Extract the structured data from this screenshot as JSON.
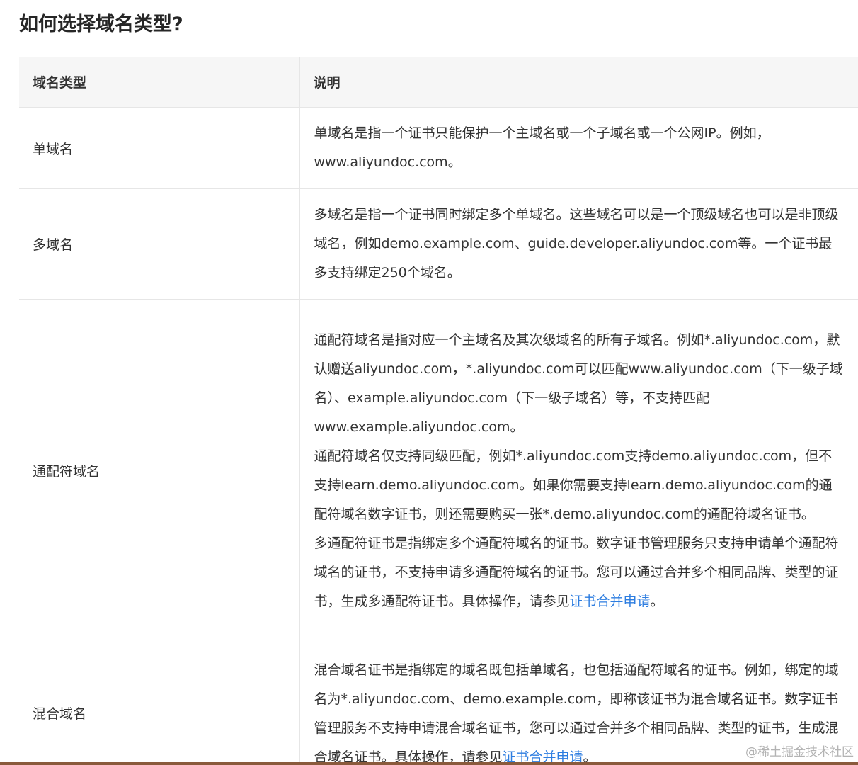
{
  "title": "如何选择域名类型?",
  "table": {
    "headers": [
      "域名类型",
      "说明"
    ],
    "rows": [
      {
        "type": "单域名",
        "paragraphs": [
          {
            "text": "单域名是指一个证书只能保护一个主域名或一个子域名或一个公网IP。例如，www.aliyundoc.com。"
          }
        ]
      },
      {
        "type": "多域名",
        "paragraphs": [
          {
            "text": "多域名是指一个证书同时绑定多个单域名。这些域名可以是一个顶级域名也可以是非顶级域名，例如demo.example.com、guide.developer.aliyundoc.com等。一个证书最多支持绑定250个域名。"
          }
        ]
      },
      {
        "type": "通配符域名",
        "paragraphs": [
          {
            "text": "通配符域名是指对应一个主域名及其次级域名的所有子域名。例如*.aliyundoc.com，默认赠送aliyundoc.com，*.aliyundoc.com可以匹配www.aliyundoc.com（下一级子域名）、example.aliyundoc.com（下一级子域名）等，不支持匹配www.example.aliyundoc.com。"
          },
          {
            "text": "通配符域名仅支持同级匹配，例如*.aliyundoc.com支持demo.aliyundoc.com，但不支持learn.demo.aliyundoc.com。如果你需要支持learn.demo.aliyundoc.com的通配符域名数字证书，则还需要购买一张*.demo.aliyundoc.com的通配符域名证书。"
          },
          {
            "text": "多通配符证书是指绑定多个通配符域名的证书。数字证书管理服务只支持申请单个通配符域名的证书，不支持申请多通配符域名的证书。您可以通过合并多个相同品牌、类型的证书，生成多通配符证书。具体操作，请参见",
            "link": "证书合并申请",
            "suffix": "。"
          }
        ]
      },
      {
        "type": "混合域名",
        "paragraphs": [
          {
            "text": "混合域名证书是指绑定的域名既包括单域名，也包括通配符域名的证书。例如，绑定的域名为*.aliyundoc.com、demo.example.com，即称该证书为混合域名证书。数字证书管理服务不支持申请混合域名证书，您可以通过合并多个相同品牌、类型的证书，生成混合域名证书。具体操作，请参见",
            "link": "证书合并申请",
            "suffix": "。"
          }
        ]
      }
    ]
  },
  "watermark": "@稀土掘金技术社区",
  "colors": {
    "link": "#2d7de0",
    "header_bg": "#f6f6f6",
    "border": "#e6e6e6"
  }
}
